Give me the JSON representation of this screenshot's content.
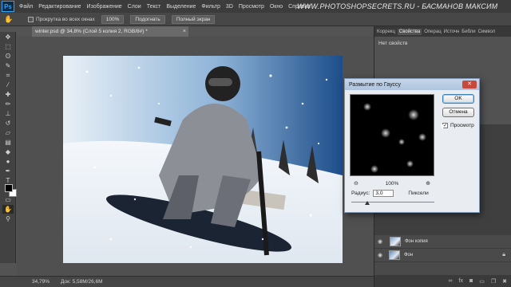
{
  "app": {
    "logo_text": "Ps"
  },
  "menu": [
    "Файл",
    "Редактирование",
    "Изображение",
    "Слои",
    "Текст",
    "Выделение",
    "Фильтр",
    "3D",
    "Просмотр",
    "Окно",
    "Справка"
  ],
  "watermark": "WWW.PHOTOSHOPSECRETS.RU - БАСМАНОВ МАКСИМ",
  "options_bar": {
    "tool_icon": "hand-icon",
    "scroll_all_label": "Прокрутка во всех окнах",
    "zoom_100_label": "100%",
    "fit_screen_label": "Подогнать",
    "full_screen_label": "Полный экран"
  },
  "toolbar": [
    "move-icon",
    "marquee-icon",
    "lasso-icon",
    "quick-select-icon",
    "crop-icon",
    "eyedropper-icon",
    "healing-icon",
    "brush-icon",
    "stamp-icon",
    "history-brush-icon",
    "eraser-icon",
    "gradient-icon",
    "blur-icon",
    "dodge-icon",
    "pen-icon",
    "type-icon",
    "path-select-icon",
    "shape-icon",
    "hand-icon",
    "zoom-icon"
  ],
  "document": {
    "tab_title": "winter.psd @ 34,8% (Слой 5 копия 2, RGB/8#) *",
    "close_glyph": "×"
  },
  "status": {
    "zoom": "34,79%",
    "doc_size": "Док: 5,58M/26,6M"
  },
  "panel": {
    "tabs": [
      "Коррекц",
      "Свойства",
      "Операц",
      "Источн",
      "Библи",
      "Символ"
    ],
    "active_tab": "Свойства",
    "properties_note": "Нет свойств"
  },
  "layers": [
    {
      "name": "Фон копия"
    },
    {
      "name": "Фон"
    }
  ],
  "dialog": {
    "title": "Размытие по Гауссу",
    "ok": "OK",
    "cancel": "Отмена",
    "preview_label": "Просмотр",
    "preview_checked": true,
    "zoom_value": "100%",
    "radius_label": "Радиус:",
    "radius_value": "3,0",
    "radius_unit": "Пиксели"
  }
}
